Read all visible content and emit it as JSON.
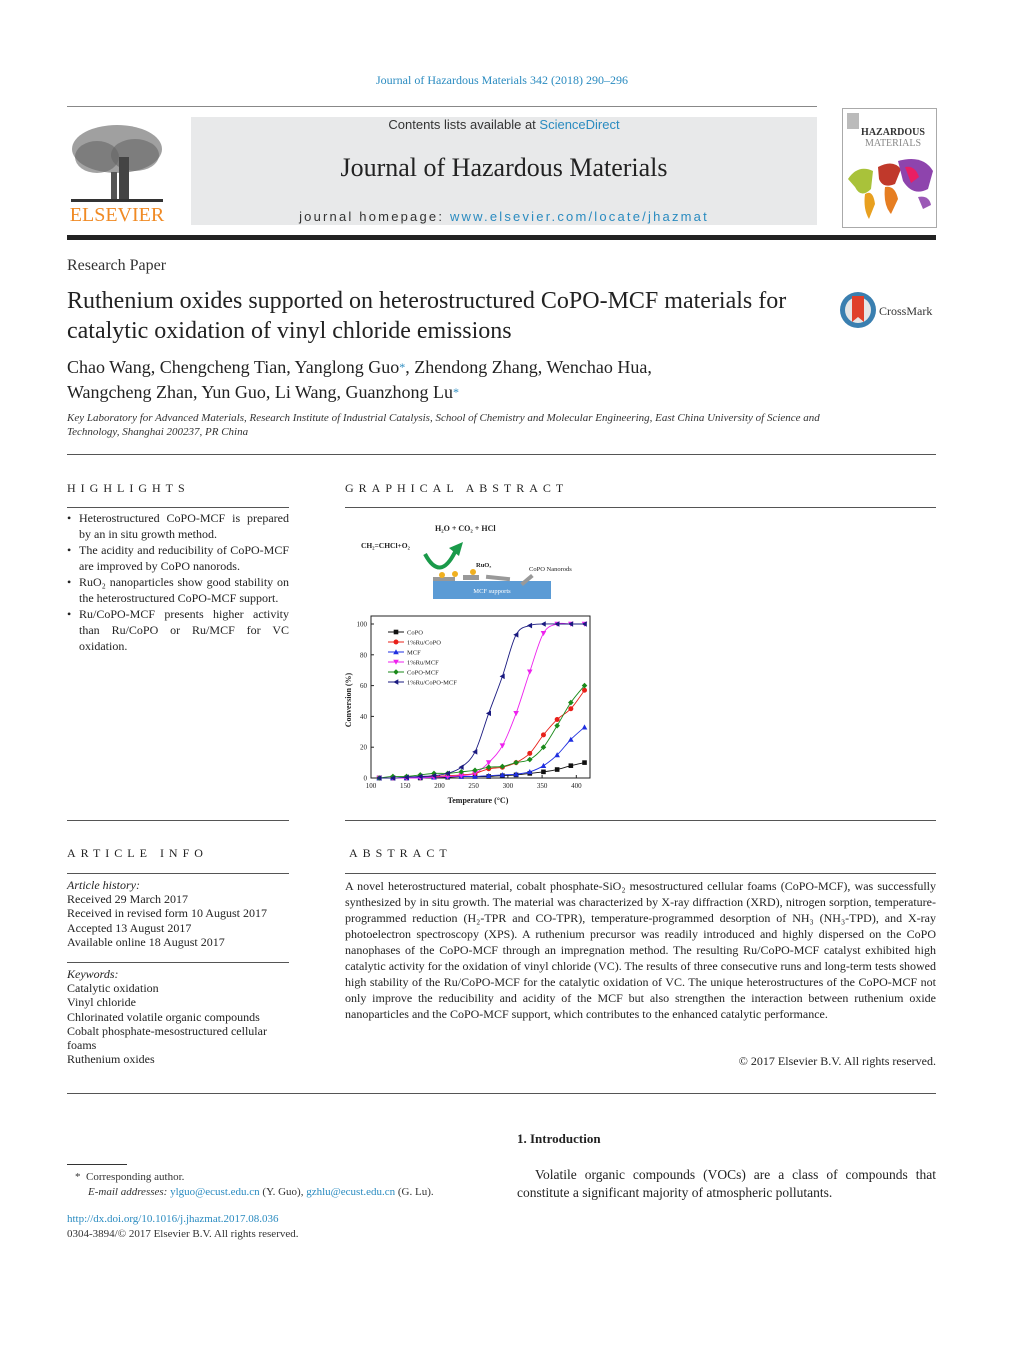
{
  "header": {
    "journal_ref": "Journal of Hazardous Materials 342 (2018) 290–296",
    "contents_prefix": "Contents lists available at ",
    "contents_link": "ScienceDirect",
    "journal_title": "Journal of Hazardous Materials",
    "homepage_prefix": "journal homepage: ",
    "homepage_link": "www.elsevier.com/locate/jhazmat",
    "publisher_logo": "ELSEVIER",
    "cover_line1": "HAZARDOUS",
    "cover_line2": "MATERIALS",
    "crossmark": "CrossMark",
    "colors": {
      "link": "#2a8bc0",
      "elsevier_orange": "#f08a24"
    }
  },
  "article": {
    "type": "Research Paper",
    "title": "Ruthenium oxides supported on heterostructured CoPO-MCF materials for catalytic oxidation of vinyl chloride emissions",
    "authors_line1_a": "Chao Wang, Chengcheng Tian, Yanglong Guo",
    "authors_line1_b": ", Zhendong Zhang, Wenchao Hua,",
    "authors_line2": "Wangcheng Zhan, Yun Guo, Li Wang, Guanzhong Lu",
    "star": "*",
    "affiliation": "Key Laboratory for Advanced Materials, Research Institute of Industrial Catalysis, School of Chemistry and Molecular Engineering, East China University of Science and Technology, Shanghai 200237, PR China"
  },
  "highlights": {
    "heading": "HIGHLIGHTS",
    "items": [
      "Heterostructured CoPO-MCF is prepared by an in situ growth method.",
      "The acidity and reducibility of CoPO-MCF are improved by CoPO nanorods.",
      "RuO₂ nanoparticles show good stability on the heterostructured CoPO-MCF support.",
      "Ru/CoPO-MCF presents higher activity than Ru/CoPO or Ru/MCF for VC oxidation."
    ]
  },
  "graphical_abstract": {
    "heading": "GRAPHICAL ABSTRACT",
    "scheme": {
      "reactants": "CH₂=CHCl+O₂",
      "products": "H₂O + CO₂ + HCl",
      "ruox_label": "RuOₓ",
      "nanorods_label": "CoPO Nanorods",
      "support_label": "MCF supports"
    }
  },
  "chart_data": {
    "type": "line",
    "title": "",
    "xlabel": "Temperature (°C)",
    "ylabel": "Conversion (%)",
    "xlim": [
      100,
      420
    ],
    "ylim": [
      0,
      100
    ],
    "xticks": [
      100,
      150,
      200,
      250,
      300,
      350,
      400
    ],
    "yticks": [
      0,
      20,
      40,
      60,
      80,
      100
    ],
    "legend_position": "top-left",
    "grid": false,
    "x": [
      112,
      132,
      152,
      172,
      192,
      212,
      232,
      252,
      272,
      292,
      312,
      332,
      352,
      372,
      392,
      412
    ],
    "series": [
      {
        "name": "CoPO",
        "color": "#111111",
        "marker": "square",
        "values": [
          0,
          0,
          0,
          0,
          0.5,
          0.5,
          1,
          1,
          1,
          1.5,
          2,
          3,
          4,
          5.5,
          8,
          10
        ]
      },
      {
        "name": "1%Ru/CoPO",
        "color": "#e8201a",
        "marker": "circle",
        "values": [
          0,
          0,
          0,
          0.5,
          1,
          1.5,
          2,
          3,
          6,
          7,
          10,
          16,
          28,
          38,
          45,
          57
        ]
      },
      {
        "name": "MCF",
        "color": "#1f2fe0",
        "marker": "triangle-up",
        "values": [
          0,
          0,
          0,
          0.5,
          0.5,
          1,
          1,
          1,
          1.5,
          2,
          2.5,
          4,
          8,
          15,
          25,
          33
        ]
      },
      {
        "name": "1%Ru/MCF",
        "color": "#ee22ee",
        "marker": "triangle-down",
        "values": [
          0,
          0,
          0,
          0,
          0.5,
          1,
          1.5,
          3,
          10,
          21,
          42,
          69,
          94,
          100,
          100,
          100
        ]
      },
      {
        "name": "CoPO-MCF",
        "color": "#1a8a1a",
        "marker": "diamond",
        "values": [
          0,
          1,
          1,
          2,
          3,
          3,
          4,
          5,
          7,
          7.5,
          10,
          12,
          20,
          34,
          49,
          60
        ]
      },
      {
        "name": "1%Ru/CoPO-MCF",
        "color": "#1a1a80",
        "marker": "triangle-left",
        "values": [
          0,
          0,
          0.5,
          1,
          1.5,
          3,
          7,
          17,
          42,
          66,
          93,
          99,
          100,
          100,
          100,
          100
        ]
      }
    ]
  },
  "article_info": {
    "heading": "ARTICLE INFO",
    "history_label": "Article history:",
    "history": [
      "Received 29 March 2017",
      "Received in revised form 10 August 2017",
      "Accepted 13 August 2017",
      "Available online 18 August 2017"
    ],
    "keywords_label": "Keywords:",
    "keywords": [
      "Catalytic oxidation",
      "Vinyl chloride",
      "Chlorinated volatile organic compounds",
      "Cobalt phosphate-mesostructured cellular foams",
      "Ruthenium oxides"
    ]
  },
  "abstract": {
    "heading": "ABSTRACT",
    "text": "A novel heterostructured material, cobalt phosphate-SiO₂ mesostructured cellular foams (CoPO-MCF), was successfully synthesized by in situ growth. The material was characterized by X-ray diffraction (XRD), nitrogen sorption, temperature-programmed reduction (H₂-TPR and CO-TPR), temperature-programmed desorption of NH₃ (NH₃-TPD), and X-ray photoelectron spectroscopy (XPS). A ruthenium precursor was readily introduced and highly dispersed on the CoPO nanophases of the CoPO-MCF through an impregnation method. The resulting Ru/CoPO-MCF catalyst exhibited high catalytic activity for the oxidation of vinyl chloride (VC). The results of three consecutive runs and long-term tests showed high stability of the Ru/CoPO-MCF for the catalytic oxidation of VC. The unique heterostructures of the CoPO-MCF not only improve the reducibility and acidity of the MCF but also strengthen the interaction between ruthenium oxide nanoparticles and the CoPO-MCF support, which contributes to the enhanced catalytic performance.",
    "copyright": "© 2017 Elsevier B.V. All rights reserved."
  },
  "introduction": {
    "heading": "1.  Introduction",
    "text": "Volatile organic compounds (VOCs) are a class of compounds that constitute a significant majority of atmospheric pollutants."
  },
  "footnote": {
    "star": "*",
    "corresponding": "Corresponding author.",
    "email_label": "E-mail addresses: ",
    "email1": "ylguo@ecust.edu.cn",
    "email1_name": " (Y. Guo), ",
    "email2": "gzhlu@ecust.edu.cn",
    "email2_name": " (G. Lu)."
  },
  "doi": {
    "link": "http://dx.doi.org/10.1016/j.jhazmat.2017.08.036",
    "issn": "0304-3894/© 2017 Elsevier B.V. All rights reserved."
  }
}
